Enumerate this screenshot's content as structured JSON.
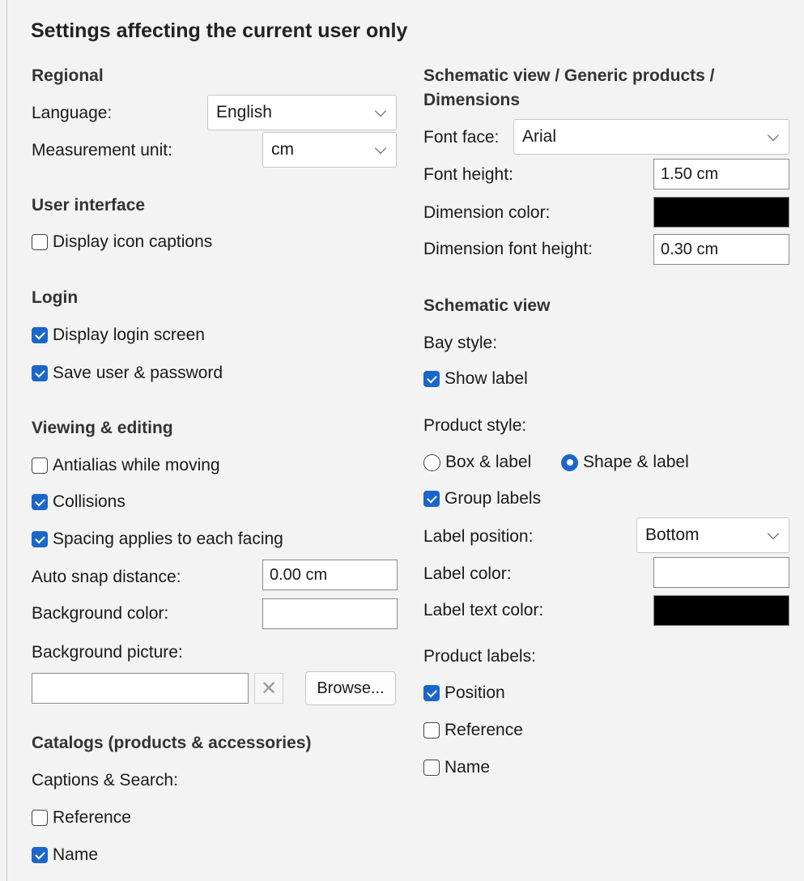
{
  "title": "Settings affecting the current user only",
  "regional": {
    "heading": "Regional",
    "language_label": "Language:",
    "language_value": "English",
    "unit_label": "Measurement unit:",
    "unit_value": "cm"
  },
  "ui": {
    "heading": "User interface",
    "icon_captions": "Display icon captions"
  },
  "login": {
    "heading": "Login",
    "display_login": "Display login screen",
    "save_user": "Save user & password"
  },
  "viewing": {
    "heading": "Viewing & editing",
    "antialias": "Antialias while moving",
    "collisions": "Collisions",
    "spacing": "Spacing applies to each facing",
    "snap_label": "Auto snap distance:",
    "snap_value": "0.00 cm",
    "bg_color_label": "Background color:",
    "bg_picture_label": "Background picture:",
    "bg_picture_value": "",
    "clear_glyph": "✕",
    "browse": "Browse..."
  },
  "catalogs": {
    "heading": "Catalogs (products & accessories)",
    "captions_label": "Captions & Search:",
    "reference": "Reference",
    "name": "Name"
  },
  "dimensions": {
    "heading_line1": "Schematic view / Generic products /",
    "heading_line2": "Dimensions",
    "font_face_label": "Font face:",
    "font_face_value": "Arial",
    "font_height_label": "Font height:",
    "font_height_value": "1.50 cm",
    "dim_color_label": "Dimension color:",
    "dim_color": "#000000",
    "dim_font_height_label": "Dimension font height:",
    "dim_font_height_value": "0.30 cm"
  },
  "schematic": {
    "heading": "Schematic view",
    "bay_style_label": "Bay style:",
    "show_label": "Show label",
    "product_style_label": "Product style:",
    "box_label": "Box & label",
    "shape_label": "Shape & label",
    "group_labels": "Group labels",
    "label_position_label": "Label position:",
    "label_position_value": "Bottom",
    "label_color_label": "Label color:",
    "label_color": "#ffffff",
    "label_text_color_label": "Label text color:",
    "label_text_color": "#000000",
    "product_labels_label": "Product labels:",
    "position": "Position",
    "reference": "Reference",
    "name": "Name"
  },
  "colors": {
    "accent": "#1b66c9",
    "background": "#f3f3f3"
  }
}
